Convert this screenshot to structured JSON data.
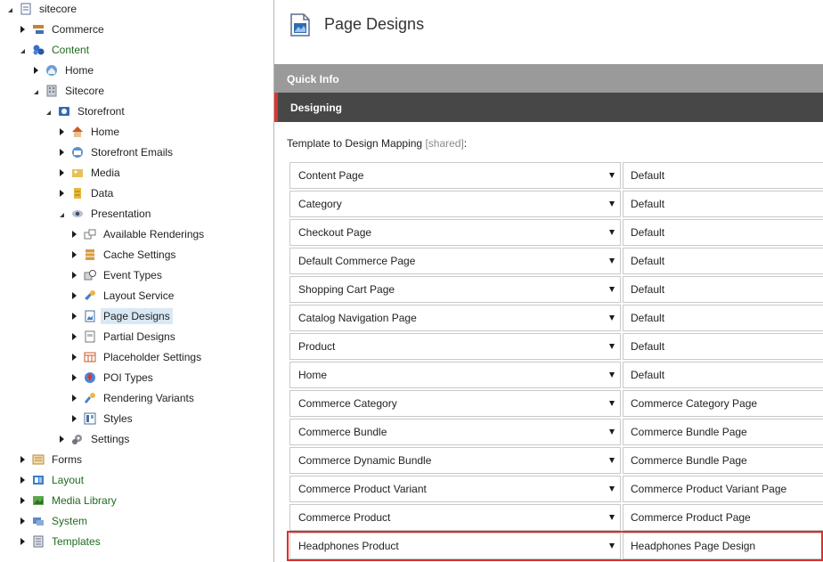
{
  "tree": {
    "nodes": [
      {
        "label": "sitecore",
        "icon": "document-icon",
        "toggle": "down",
        "color": "normal"
      },
      {
        "label": "Commerce",
        "icon": "commerce-icon",
        "toggle": "right",
        "color": "normal"
      },
      {
        "label": "Content",
        "icon": "content-icon",
        "toggle": "down",
        "color": "green"
      },
      {
        "label": "Home",
        "icon": "globe-home-icon",
        "toggle": "right",
        "color": "normal"
      },
      {
        "label": "Sitecore",
        "icon": "building-icon",
        "toggle": "down",
        "color": "normal"
      },
      {
        "label": "Storefront",
        "icon": "storefront-icon",
        "toggle": "down",
        "color": "normal"
      },
      {
        "label": "Home",
        "icon": "house-icon",
        "toggle": "right",
        "color": "normal"
      },
      {
        "label": "Storefront Emails",
        "icon": "email-icon",
        "toggle": "right",
        "color": "normal"
      },
      {
        "label": "Media",
        "icon": "media-icon",
        "toggle": "right",
        "color": "normal"
      },
      {
        "label": "Data",
        "icon": "data-icon",
        "toggle": "right",
        "color": "normal"
      },
      {
        "label": "Presentation",
        "icon": "eye-icon",
        "toggle": "down",
        "color": "normal"
      },
      {
        "label": "Available Renderings",
        "icon": "renderings-icon",
        "toggle": "right",
        "color": "normal"
      },
      {
        "label": "Cache Settings",
        "icon": "cache-icon",
        "toggle": "right",
        "color": "normal"
      },
      {
        "label": "Event Types",
        "icon": "event-icon",
        "toggle": "right",
        "color": "normal"
      },
      {
        "label": "Layout Service",
        "icon": "layout-service-icon",
        "toggle": "right",
        "color": "normal"
      },
      {
        "label": "Page Designs",
        "icon": "page-design-icon",
        "toggle": "right",
        "color": "normal",
        "selected": true
      },
      {
        "label": "Partial Designs",
        "icon": "partial-design-icon",
        "toggle": "right",
        "color": "normal"
      },
      {
        "label": "Placeholder Settings",
        "icon": "placeholder-icon",
        "toggle": "right",
        "color": "normal"
      },
      {
        "label": "POI Types",
        "icon": "poi-icon",
        "toggle": "right",
        "color": "normal"
      },
      {
        "label": "Rendering Variants",
        "icon": "variants-icon",
        "toggle": "right",
        "color": "normal"
      },
      {
        "label": "Styles",
        "icon": "styles-icon",
        "toggle": "right",
        "color": "normal"
      },
      {
        "label": "Settings",
        "icon": "gear-icon",
        "toggle": "right",
        "color": "normal"
      },
      {
        "label": "Forms",
        "icon": "forms-icon",
        "toggle": "right",
        "color": "normal"
      },
      {
        "label": "Layout",
        "icon": "layout-icon",
        "toggle": "right",
        "color": "green"
      },
      {
        "label": "Media Library",
        "icon": "media-library-icon",
        "toggle": "right",
        "color": "green"
      },
      {
        "label": "System",
        "icon": "system-icon",
        "toggle": "right",
        "color": "green"
      },
      {
        "label": "Templates",
        "icon": "templates-icon",
        "toggle": "right",
        "color": "green"
      }
    ]
  },
  "header": {
    "title": "Page Designs",
    "icon": "page-design-large-icon"
  },
  "sections": {
    "quick_info": "Quick Info",
    "designing": "Designing"
  },
  "field": {
    "label": "Template to Design Mapping",
    "shared": "[shared]",
    "colon": ":"
  },
  "mappings": [
    {
      "template": "Content Page",
      "design": "Default"
    },
    {
      "template": "Category",
      "design": "Default"
    },
    {
      "template": "Checkout Page",
      "design": "Default"
    },
    {
      "template": "Default Commerce Page",
      "design": "Default"
    },
    {
      "template": "Shopping Cart Page",
      "design": "Default"
    },
    {
      "template": "Catalog Navigation Page",
      "design": "Default"
    },
    {
      "template": "Product",
      "design": "Default"
    },
    {
      "template": "Home",
      "design": "Default"
    },
    {
      "template": "Commerce Category",
      "design": "Commerce Category Page"
    },
    {
      "template": "Commerce Bundle",
      "design": "Commerce Bundle Page"
    },
    {
      "template": "Commerce Dynamic Bundle",
      "design": "Commerce Bundle Page"
    },
    {
      "template": "Commerce Product Variant",
      "design": "Commerce Product Variant Page"
    },
    {
      "template": "Commerce Product",
      "design": "Commerce Product Page"
    },
    {
      "template": "Headphones Product",
      "design": "Headphones Page Design"
    }
  ],
  "colors": {
    "highlight": "#d9302b",
    "green_text": "#1e6b1e",
    "selected_bg": "#d8e9f5",
    "quick_info_bg": "#9a9a9a",
    "designing_bg": "#474747"
  }
}
